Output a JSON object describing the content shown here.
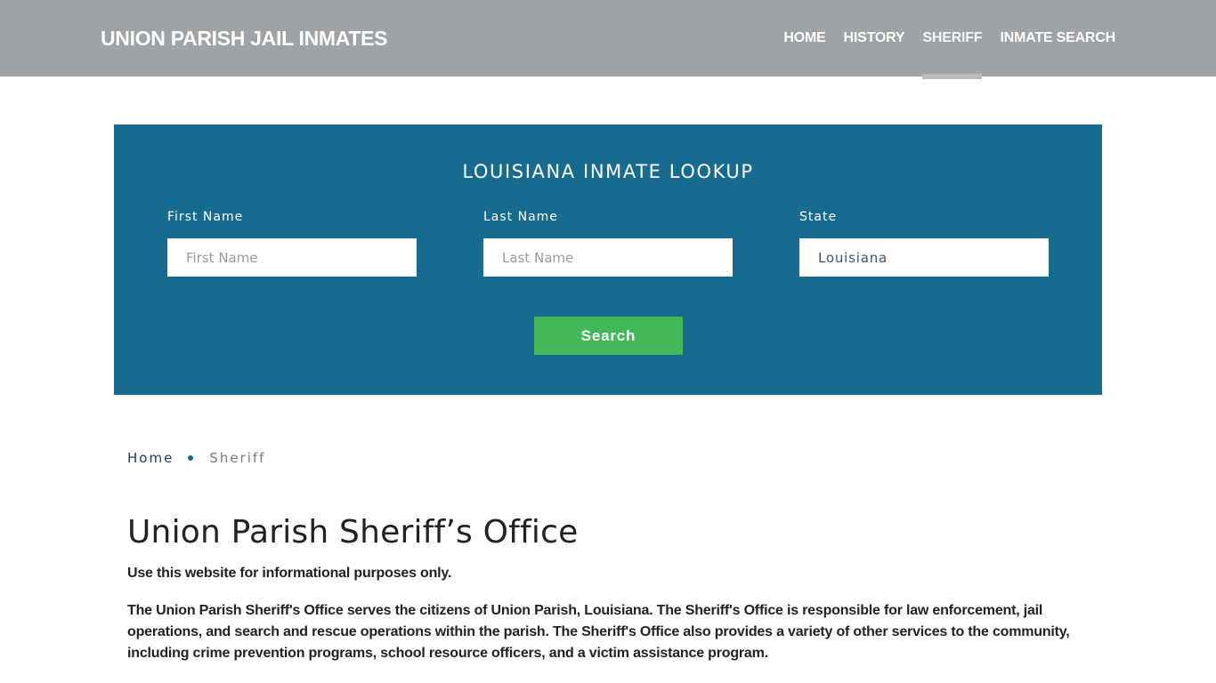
{
  "header": {
    "brand": "UNION PARISH JAIL INMATES",
    "nav": [
      {
        "label": "HOME",
        "active": false
      },
      {
        "label": "HISTORY",
        "active": false
      },
      {
        "label": "SHERIFF",
        "active": true
      },
      {
        "label": "INMATE SEARCH",
        "active": false
      }
    ]
  },
  "lookup": {
    "title": "LOUISIANA INMATE LOOKUP",
    "first_name": {
      "label": "First Name",
      "placeholder": "First Name",
      "value": ""
    },
    "last_name": {
      "label": "Last Name",
      "placeholder": "Last Name",
      "value": ""
    },
    "state": {
      "label": "State",
      "value": "Louisiana"
    },
    "search_label": "Search",
    "colors": {
      "panel": "#176b8e",
      "button": "#44b758"
    }
  },
  "breadcrumb": {
    "items": [
      {
        "label": "Home"
      },
      {
        "label": "Sheriff"
      }
    ]
  },
  "main": {
    "title": "Union Parish Sheriff’s Office",
    "notice": "Use this website for informational purposes only.",
    "paragraph": "The Union Parish Sheriff's Office serves the citizens of Union Parish, Louisiana. The Sheriff's Office is responsible for law enforcement, jail operations, and search and rescue operations within the parish. The Sheriff's Office also provides a variety of other services to the community, including crime prevention programs, school resource officers, and a victim assistance program."
  }
}
